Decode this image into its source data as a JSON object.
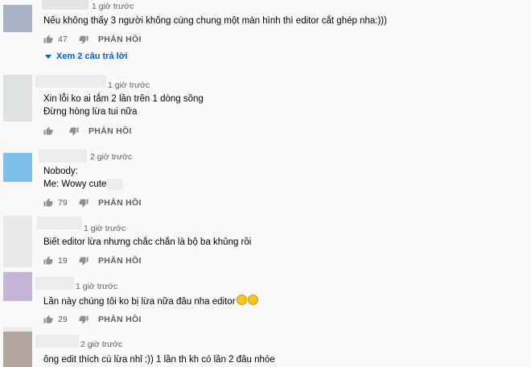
{
  "labels": {
    "reply": "PHẢN HỒI"
  },
  "comments": [
    {
      "time": "1 giờ trước",
      "lines": [
        "Nếu không thấy 3 người không cùng chung một màn hình thì editor cắt ghép nha:)))"
      ],
      "likes": "47",
      "avatar_color": "#aab2c6",
      "replies_label": "Xem 2 câu trả lời"
    },
    {
      "time": "1 giờ trước",
      "lines": [
        "Xin lỗi ko ai tắm 2 lần trên 1 dòng sông",
        "Đừng hòng lừa tui nữa"
      ],
      "likes": "",
      "avatar_color": "#dfe2e2"
    },
    {
      "time": "2 giờ trước",
      "lines": [
        "Nobody:",
        "Me: Wowy cute"
      ],
      "likes": "79",
      "avatar_color": "#7cc0ea"
    },
    {
      "time": "1 giờ trước",
      "lines": [
        "Biết editor lừa nhưng chắc chắn là bộ ba khủng rồi"
      ],
      "likes": "19",
      "avatar_color": "#e9e9e9"
    },
    {
      "time": "1 giờ trước",
      "lines": [
        "Lần này chúng tôi ko bị lừa nữa đâu nha editor"
      ],
      "likes": "29",
      "avatar_color": "#c5b5d6"
    },
    {
      "time": "2 giờ trước",
      "lines": [
        "ông edit thích cú lừa nhỉ :)) 1 lần th kh có lần 2 đâu nhóe"
      ],
      "likes": "",
      "avatar_color": "#b3a69f"
    }
  ]
}
